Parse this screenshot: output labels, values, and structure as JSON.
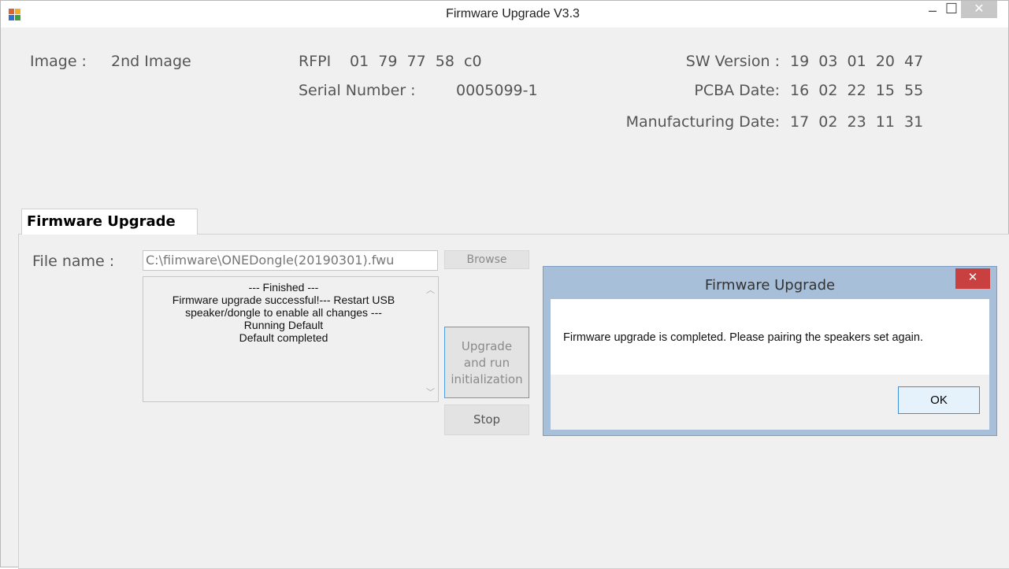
{
  "window": {
    "title": "Firmware Upgrade V3.3",
    "controls": {
      "minimize": "–",
      "maximize": "☐",
      "close": "✕"
    }
  },
  "info": {
    "image_label": "Image :",
    "image_value": "2nd Image",
    "rfpi_label": "RFPI",
    "rfpi_value": "01  79  77  58  c0",
    "serial_label": "Serial Number :",
    "serial_value": "0005099-1",
    "sw_version_label": "SW Version :",
    "sw_version_value": "19  03  01  20  47",
    "pcba_date_label": "PCBA Date:",
    "pcba_date_value": "16  02  22  15  55",
    "mfg_date_label": "Manufacturing Date:",
    "mfg_date_value": "17  02  23  11  31"
  },
  "tab": {
    "label": "Firmware Upgrade"
  },
  "form": {
    "file_label": "File name :",
    "file_value": "C:\\fiimware\\ONEDongle(20190301).fwu",
    "browse_label": "Browse",
    "log_lines": [
      "--- Finished ---",
      "Firmware upgrade successful!--- Restart USB",
      "speaker/dongle to enable all changes ---",
      "Running Default",
      "Default completed"
    ],
    "upgrade_label_lines": [
      "Upgrade",
      "and run",
      "initialization"
    ],
    "stop_label": "Stop"
  },
  "dialog": {
    "title": "Firmware Upgrade",
    "close": "✕",
    "message": "Firmware upgrade is completed. Please pairing the speakers set again.",
    "ok_label": "OK"
  },
  "colors": {
    "dialog_frame": "#a8bfd9",
    "close_red": "#c94040",
    "focus_blue": "#3c8fd9"
  }
}
